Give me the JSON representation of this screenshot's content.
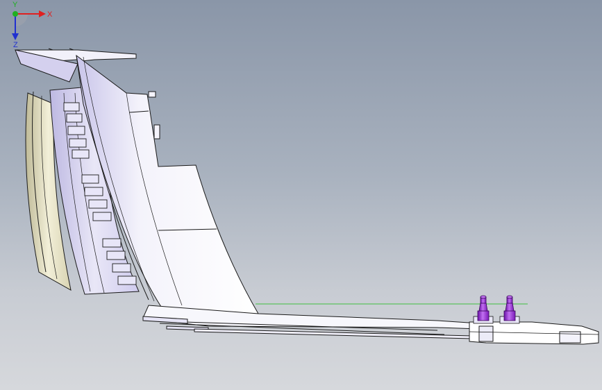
{
  "viewport": {
    "background_top": "#8a96a8",
    "background_bottom": "#d6d8dc"
  },
  "model": {
    "body_color": "#ffffff",
    "shade_color": "#d9d6f0",
    "edge_color": "#1a1a1a",
    "bezel_color": "#e6e2c6",
    "pin_color": "#9b30d8",
    "guide_line_color": "#3fbf3f"
  },
  "triad": {
    "x_label": "X",
    "y_label": "Y",
    "z_label": "Z",
    "x_color": "#e02020",
    "y_color": "#20b020",
    "z_color": "#2030d0"
  }
}
